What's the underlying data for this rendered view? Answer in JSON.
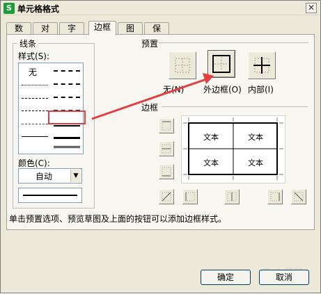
{
  "window": {
    "title": "单元格格式",
    "app_icon": "S"
  },
  "tabs": [
    {
      "label": "数字",
      "active": false
    },
    {
      "label": "对齐",
      "active": false
    },
    {
      "label": "字体",
      "active": false
    },
    {
      "label": "边框",
      "active": true
    },
    {
      "label": "图案",
      "active": false
    },
    {
      "label": "保护",
      "active": false
    }
  ],
  "line": {
    "group_title": "线条",
    "style_label": "样式(S):",
    "none_label": "无",
    "color_label": "颜色(C):",
    "color_value": "自动"
  },
  "preset": {
    "group_title": "预置",
    "none": "无(N)",
    "outline": "外边框(O)",
    "inside": "内部(I)"
  },
  "border": {
    "group_title": "边框",
    "cells": [
      "文本",
      "文本",
      "文本",
      "文本"
    ]
  },
  "hint": "单击预置选项、预览草图及上面的按钮可以添加边框样式。",
  "buttons": {
    "ok": "确定",
    "cancel": "取消"
  },
  "colors": {
    "highlight": "#e53e40",
    "arrow": "#e53e40"
  }
}
